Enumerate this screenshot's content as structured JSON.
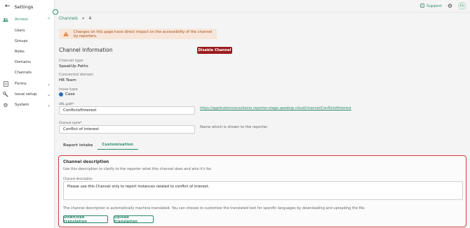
{
  "sidebar": {
    "back_label": "Settings",
    "items": [
      {
        "label": "Access",
        "icon": "users-icon",
        "active": true
      },
      {
        "label": "Users"
      },
      {
        "label": "Groups"
      },
      {
        "label": "Roles"
      },
      {
        "label": "Domains"
      },
      {
        "label": "Channels"
      },
      {
        "label": "Forms",
        "icon": "document-icon"
      },
      {
        "label": "Issue setup",
        "icon": "wrench-icon"
      },
      {
        "label": "System",
        "icon": "gear-icon"
      }
    ]
  },
  "header": {
    "breadcrumb": {
      "parent": "Channels",
      "separator": "»",
      "current": "4"
    },
    "support_label": "Support",
    "avatar_initials": "LL"
  },
  "warning": {
    "text": "Changes on this page have direct impact on the accessibility of the channel by reporters."
  },
  "channel_info": {
    "title": "Channel Information",
    "disable_button": "Disable Channel",
    "channel_type_label": "Channel type",
    "channel_type_value": "SpeakUp Paths",
    "connected_domain_label": "Connected domain",
    "connected_domain_value": "HR Team",
    "issue_type_label": "Issue type",
    "issue_type_value": "Case",
    "url_path_label": "URL path*",
    "url_path_value": "ConflictofInterest",
    "url_link": "https://applicationconsultants.reporter-stage.speakup.cloud/channel/ConflictofInterest",
    "channel_name_label": "Channel name*",
    "channel_name_value": "Conflict of interest",
    "channel_name_hint": "Name which is shown to the reporter."
  },
  "tabs": [
    {
      "label": "Report intake",
      "active": false
    },
    {
      "label": "Customisation",
      "active": true
    }
  ],
  "customisation": {
    "title": "Channel description",
    "description": "Use this description to clarify to the reporter what this channel does and who it's for.",
    "field_label": "Channel description",
    "field_value": "Please use this Channel only to report instances related to conflict of interest.",
    "note": "The channel description is automatically machine translated. You can choose to customize the translated text for specific languages by downloading and uploading the file.",
    "download_button": "Download translation",
    "upload_button": "Upload translation"
  },
  "colors": {
    "accent": "#2c8a6e",
    "danger": "#9b1c1c",
    "highlight_border": "#d9383a",
    "warning_bg": "#f7e6d9",
    "warning_text": "#a5521b"
  }
}
